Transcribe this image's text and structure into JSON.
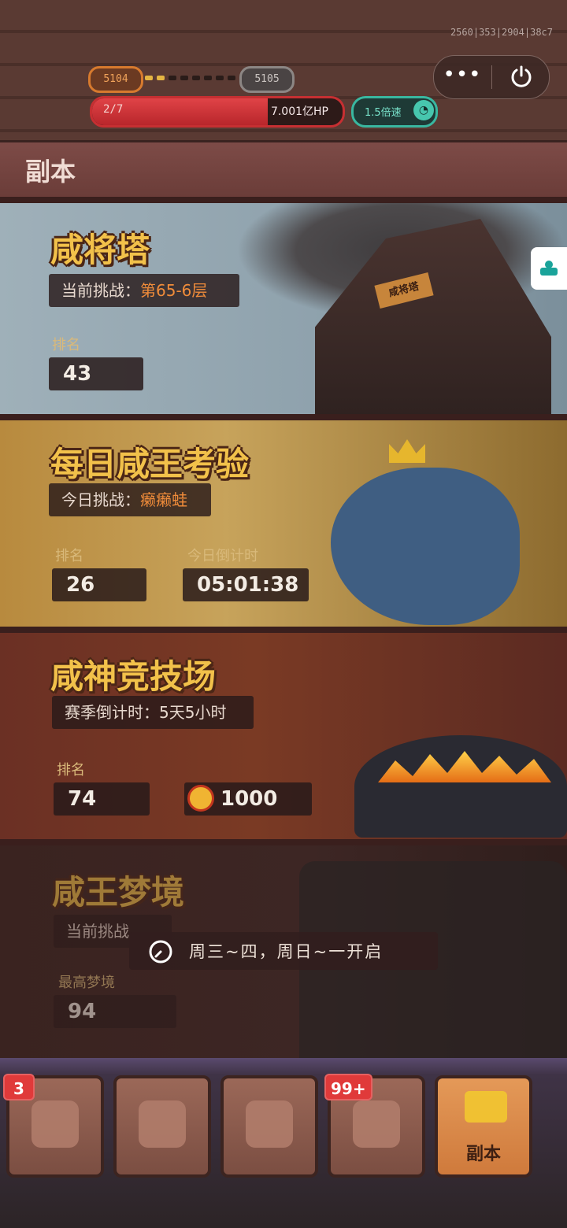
{
  "status": {
    "build_id": "2560|353|2904|38c7",
    "level_current": "5104",
    "level_next": "5105",
    "level_progress_fraction": 0.25,
    "hp_stage": "2/7",
    "hp_value": "7.001亿HP",
    "hp_fill_fraction": 0.7,
    "speed_label": "1.5倍速",
    "accent_red": "#c62f32",
    "accent_teal": "#39b7a0"
  },
  "miniapp": {
    "more_icon": "more-dots-icon",
    "close_icon": "power-icon"
  },
  "header": {
    "title": "副本"
  },
  "cards": {
    "tower": {
      "title": "咸将塔",
      "challenge_prefix": "当前挑战：",
      "challenge_value": "第65-6层",
      "rank_label": "排名",
      "rank_value": "43",
      "sign_text": "咸将塔"
    },
    "daily": {
      "title": "每日咸王考验",
      "challenge_prefix": "今日挑战：",
      "challenge_value": "癞癞蛙",
      "rank_label": "排名",
      "rank_value": "26",
      "countdown_label": "今日倒计时",
      "countdown_value": "05:01:38"
    },
    "arena": {
      "title": "咸神竞技场",
      "season_text": "赛季倒计时：5天5小时",
      "rank_label": "排名",
      "rank_value": "74",
      "points_value": "1000"
    },
    "dream": {
      "title": "咸王梦境",
      "challenge_prefix": "当前挑战",
      "best_label": "最高梦境",
      "best_value": "94",
      "lock_text": "周三~四，周日~一开启"
    }
  },
  "nav": {
    "items": [
      {
        "name": "heroes",
        "badge": "3"
      },
      {
        "name": "equipment",
        "badge": ""
      },
      {
        "name": "skills",
        "badge": ""
      },
      {
        "name": "chests",
        "badge": "99+"
      },
      {
        "name": "dungeon",
        "label": "副本",
        "active": true
      }
    ]
  }
}
